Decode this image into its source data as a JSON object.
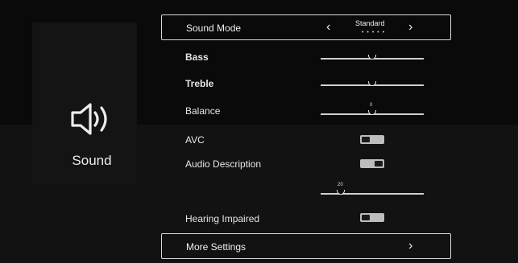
{
  "category": {
    "label": "Sound",
    "icon": "speaker-icon"
  },
  "sound_mode": {
    "label": "Sound Mode",
    "value": "Standard",
    "dots": "• • • • •",
    "prev_icon": "chevron-left-icon",
    "next_icon": "chevron-right-icon"
  },
  "bass": {
    "label": "Bass"
  },
  "treble": {
    "label": "Treble"
  },
  "balance": {
    "label": "Balance",
    "value": "0"
  },
  "avc": {
    "label": "AVC",
    "state": "off"
  },
  "audio_description": {
    "label": "Audio Description",
    "state": "on"
  },
  "ad_volume": {
    "value": "20"
  },
  "hearing_impaired": {
    "label": "Hearing Impaired",
    "state": "off"
  },
  "more_settings": {
    "label": "More Settings",
    "icon": "chevron-right-icon"
  },
  "colors": {
    "background": "#0b0b0b",
    "panel": "#141414",
    "text": "#e6e6e6",
    "toggle": "#bdbdbd"
  }
}
